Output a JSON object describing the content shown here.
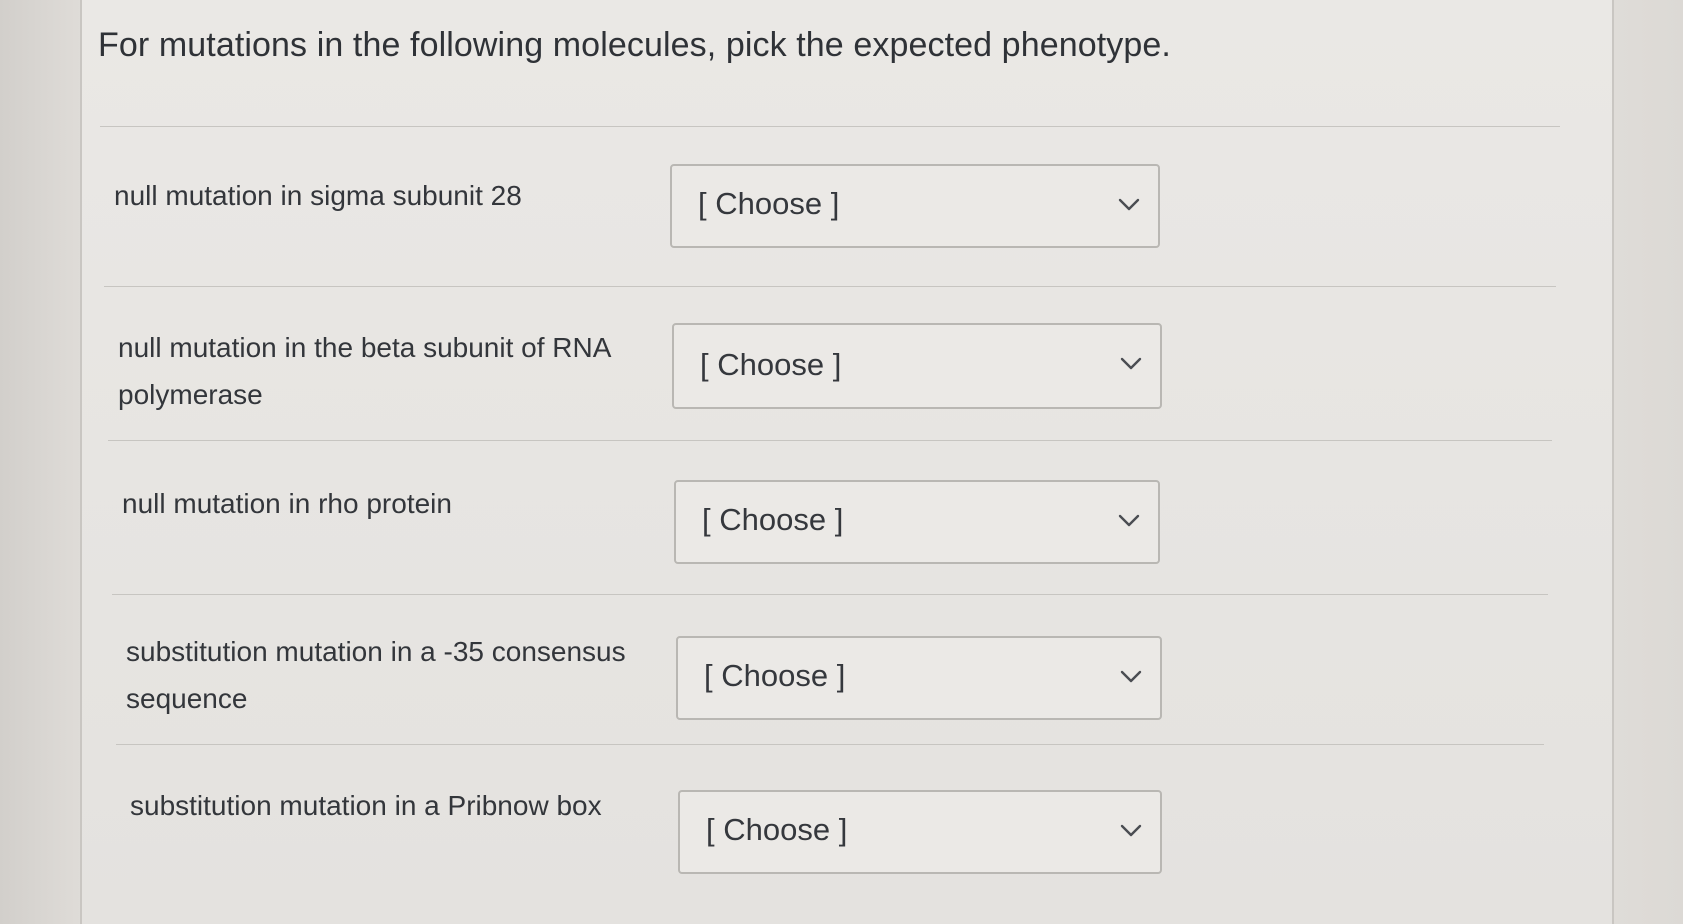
{
  "question": {
    "title": "For mutations in the following molecules, pick the expected phenotype."
  },
  "rows": [
    {
      "label": "null mutation in sigma subunit 28",
      "select_value": "[ Choose ]"
    },
    {
      "label": "null mutation in the beta subunit of RNA polymerase",
      "select_value": "[ Choose ]"
    },
    {
      "label": "null mutation in rho protein",
      "select_value": "[ Choose ]"
    },
    {
      "label": "substitution mutation in a -35 consensus sequence",
      "select_value": "[ Choose ]"
    },
    {
      "label": "substitution mutation in a Pribnow box",
      "select_value": "[ Choose ]"
    }
  ],
  "icons": {
    "dropdown": "chevron-down-icon"
  }
}
